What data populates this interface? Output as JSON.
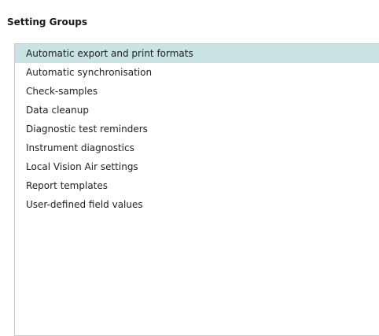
{
  "panel": {
    "title": "Setting Groups"
  },
  "setting_groups": {
    "selected_index": 0,
    "items": [
      {
        "label": "Automatic export and print formats"
      },
      {
        "label": "Automatic synchronisation"
      },
      {
        "label": "Check-samples"
      },
      {
        "label": "Data cleanup"
      },
      {
        "label": "Diagnostic test reminders"
      },
      {
        "label": "Instrument diagnostics"
      },
      {
        "label": "Local Vision Air settings"
      },
      {
        "label": "Report templates"
      },
      {
        "label": "User-defined field values"
      }
    ]
  },
  "colors": {
    "selected_background": "#c7e3e3",
    "border": "#c9c9c9"
  }
}
